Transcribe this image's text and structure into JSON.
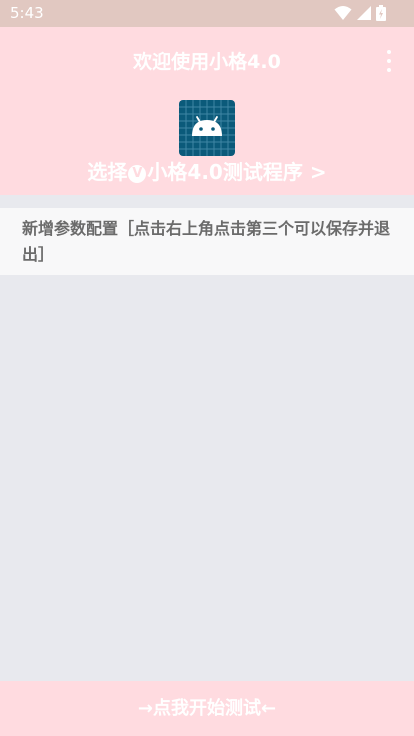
{
  "status_bar": {
    "time": "5:43"
  },
  "header": {
    "title": "欢迎使用小格4.0",
    "select_prefix": "选择",
    "select_badge": "V",
    "select_suffix": "小格4.0测试程序 >"
  },
  "list": {
    "items": [
      {
        "label": "新增参数配置［点击右上角点击第三个可以保存并退出］"
      }
    ]
  },
  "footer": {
    "start_label": "→点我开始测试←"
  },
  "colors": {
    "status_bar": "#e1c8c1",
    "header_bg": "#ffdbe0",
    "content_bg": "#e8e9ee",
    "list_item_bg": "#f8f8f9",
    "logo_bg": "#0b5a7a",
    "android_green": "#ffffff"
  },
  "icons": {
    "wifi": "wifi-icon",
    "signal": "cellular-signal-icon",
    "battery": "battery-icon",
    "menu": "more-vert-icon",
    "logo": "android-app-icon"
  }
}
